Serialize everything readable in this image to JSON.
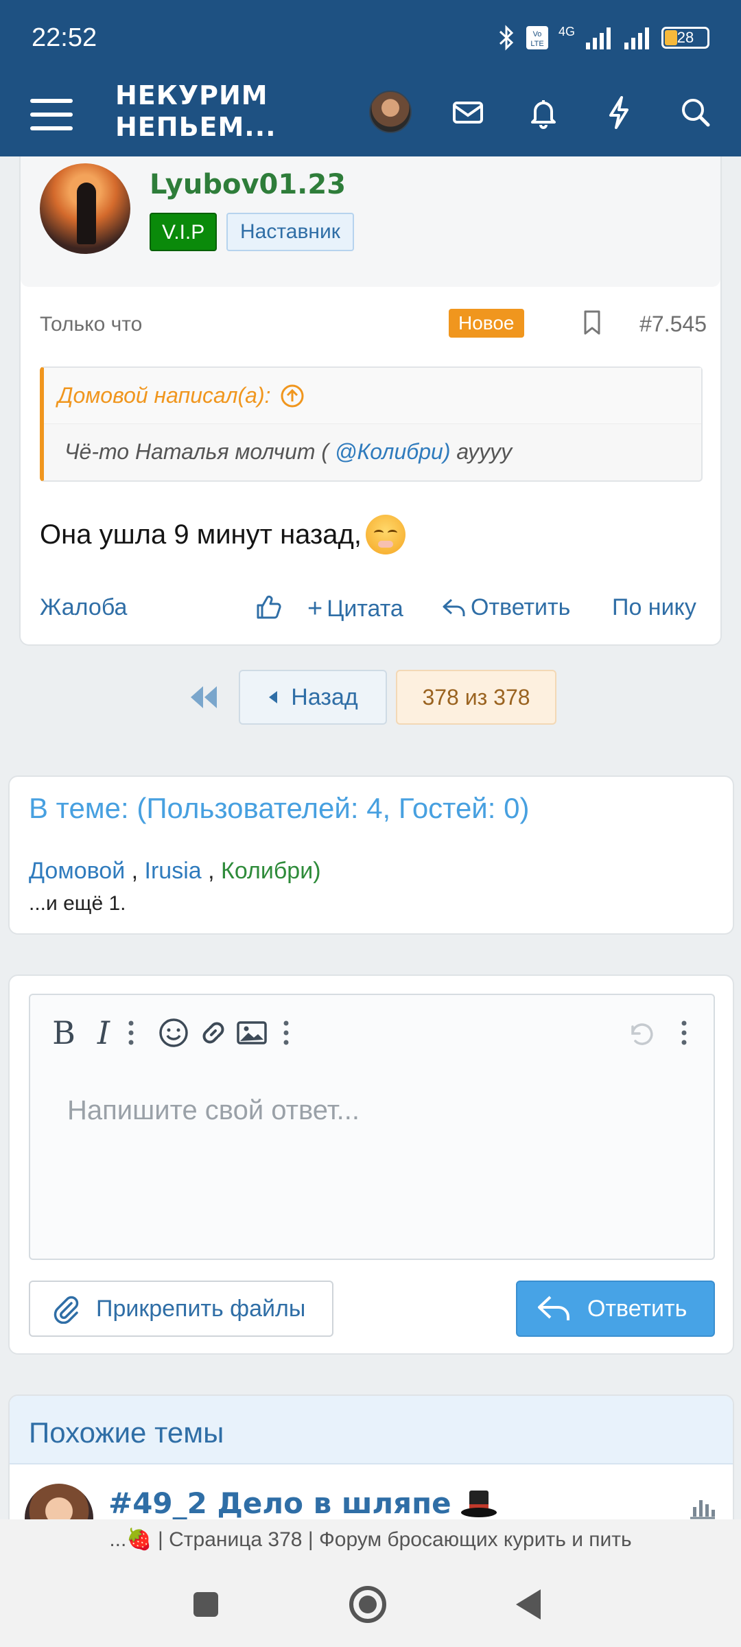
{
  "status": {
    "time": "22:52",
    "network": "4G",
    "battery": "28"
  },
  "header": {
    "logo_line1": "НЕКУРИМ",
    "logo_line2": "НЕПЬЕМ..."
  },
  "post": {
    "username": "Lyubov01.23",
    "badge_vip": "V.I.P",
    "badge_role": "Наставник",
    "time": "Только что",
    "new_label": "Новое",
    "post_number": "#7.545",
    "quote_author": "Домовой написал(а):",
    "quote_text_before": "Чё-то Наталья молчит ( ",
    "quote_mention": "@Колибри)",
    "quote_text_after": " ауууу",
    "text": "Она ушла 9 минут назад,",
    "actions": {
      "report": "Жалоба",
      "quote": "Цитата",
      "reply": "Ответить",
      "by_nick": "По нику"
    }
  },
  "pager": {
    "back": "Назад",
    "indicator": "378 из 378"
  },
  "in_thread": {
    "title": "В теме: (Пользователей: 4, Гостей: 0)",
    "users": [
      {
        "name": "Домовой",
        "color": "#2f7bbd"
      },
      {
        "name": "Irusia",
        "color": "#2f7bbd"
      },
      {
        "name": "Колибри)",
        "color": "#2e8b3a"
      }
    ],
    "more": "...и ещё 1."
  },
  "reply": {
    "placeholder": "Напишите свой ответ...",
    "attach": "Прикрепить файлы",
    "send": "Ответить"
  },
  "similar": {
    "heading": "Похожие темы",
    "item_title": "#49_2 Дело в шляпе"
  },
  "browser": {
    "page_title": "...🍓 | Страница 378 | Форум бросающих курить и пить"
  }
}
